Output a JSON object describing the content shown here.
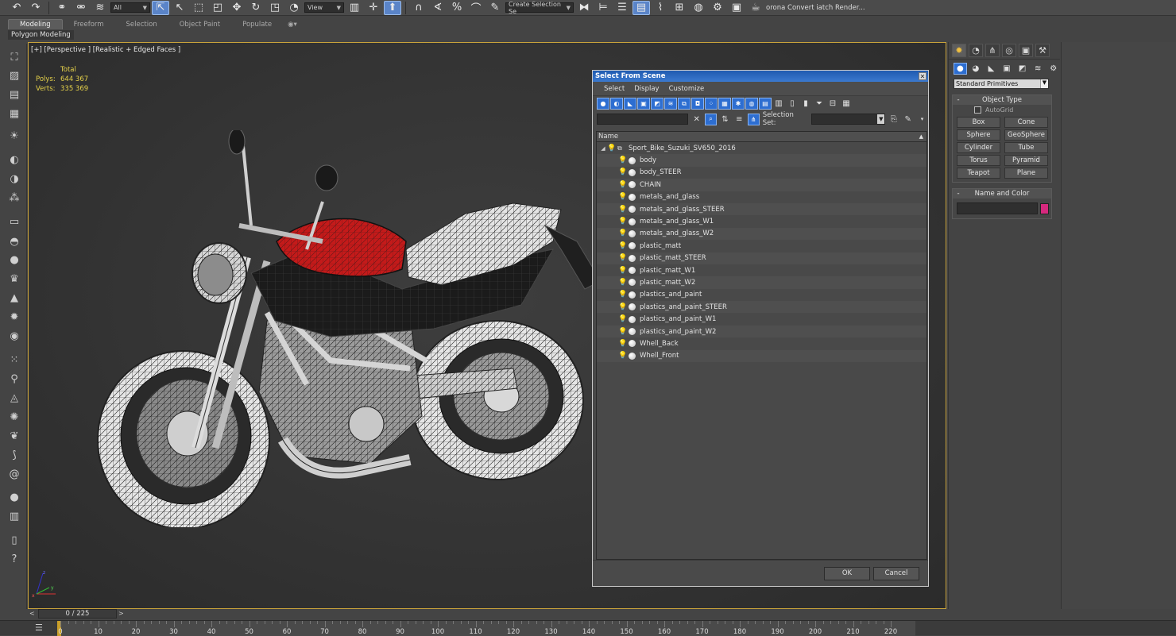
{
  "toolbar": {
    "filter_value": "All",
    "refcoord_value": "View",
    "selection_set_placeholder": "Create Selection Se",
    "right_text": "orona Convert iatch Render..."
  },
  "ribbon": {
    "tabs": [
      "Modeling",
      "Freeform",
      "Selection",
      "Object Paint",
      "Populate"
    ],
    "active_tab": "Modeling",
    "subtitle": "Polygon Modeling"
  },
  "viewport": {
    "label": "[+] [Perspective ] [Realistic + Edged Faces ]",
    "stats": {
      "header": "Total",
      "polys_label": "Polys:",
      "polys_value": "644 367",
      "verts_label": "Verts:",
      "verts_value": "335 369"
    }
  },
  "dialog": {
    "title": "Select From Scene",
    "menu": [
      "Select",
      "Display",
      "Customize"
    ],
    "selection_set_label": "Selection Set:",
    "column_name": "Name",
    "root": "Sport_Bike_Suzuki_SV650_2016",
    "objects": [
      "body",
      "body_STEER",
      "CHAIN",
      "metals_and_glass",
      "metals_and_glass_STEER",
      "metals_and_glass_W1",
      "metals_and_glass_W2",
      "plastic_matt",
      "plastic_matt_STEER",
      "plastic_matt_W1",
      "plastic_matt_W2",
      "plastics_and_paint",
      "plastics_and_paint_STEER",
      "plastics_and_paint_W1",
      "plastics_and_paint_W2",
      "Whell_Back",
      "Whell_Front"
    ],
    "ok_label": "OK",
    "cancel_label": "Cancel"
  },
  "command_panel": {
    "dropdown_value": "Standard Primitives",
    "object_type_title": "Object Type",
    "autogrid_label": "AutoGrid",
    "primitives": [
      "Box",
      "Cone",
      "Sphere",
      "GeoSphere",
      "Cylinder",
      "Tube",
      "Torus",
      "Pyramid",
      "Teapot",
      "Plane"
    ],
    "name_color_title": "Name and Color",
    "object_color": "#d6297e"
  },
  "timeline": {
    "frame_display": "0 / 225",
    "ticks": [
      "0",
      "10",
      "20",
      "30",
      "40",
      "50",
      "60",
      "70",
      "80",
      "90",
      "100",
      "110",
      "120",
      "130",
      "140",
      "150",
      "160",
      "170",
      "180",
      "190",
      "200",
      "210",
      "220"
    ]
  },
  "colors": {
    "viewport_border": "#c8a23a",
    "dialog_title": "#1f5bb0",
    "selected_tool": "#2d6ed1",
    "stats_text": "#e6d24a"
  }
}
